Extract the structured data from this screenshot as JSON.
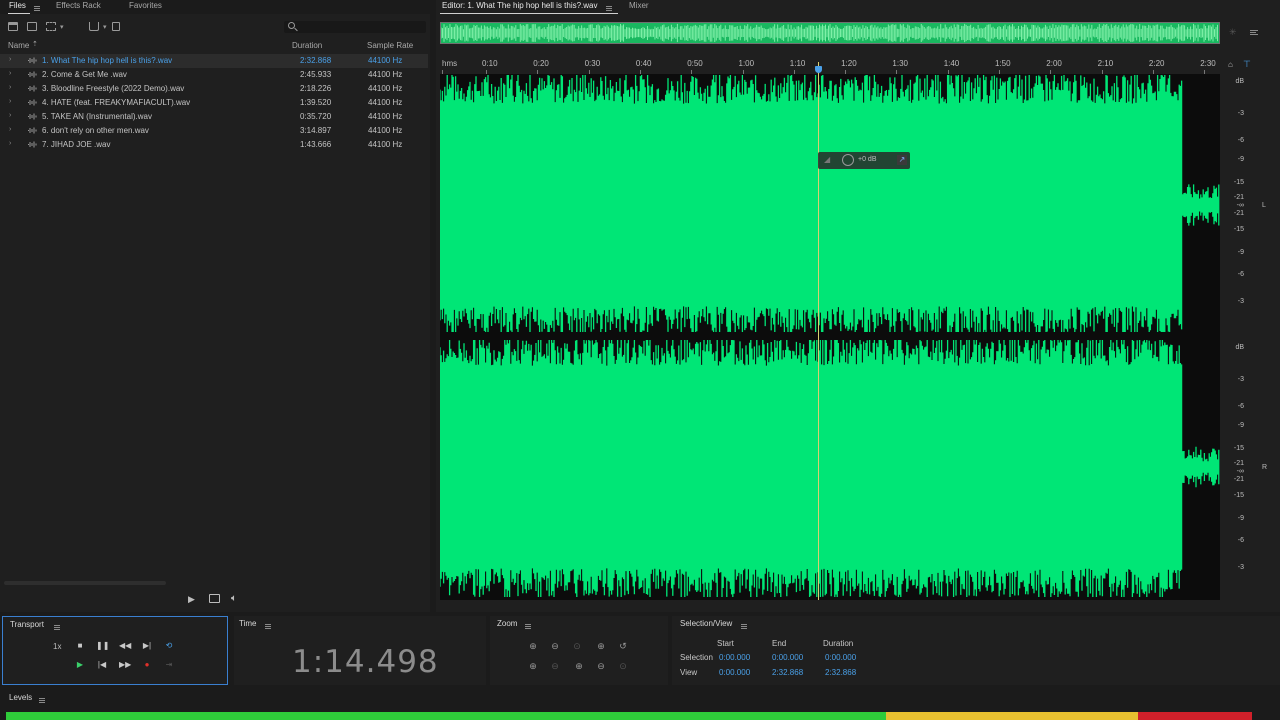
{
  "files_panel": {
    "tabs": [
      {
        "label": "Files",
        "active": true
      },
      {
        "label": "Effects Rack",
        "active": false
      },
      {
        "label": "Favorites",
        "active": false
      }
    ],
    "search": {
      "placeholder": ""
    },
    "columns": {
      "name": "Name",
      "duration": "Duration",
      "sample_rate": "Sample Rate"
    },
    "files": [
      {
        "name": "1. What The hip hop hell is this?.wav",
        "duration": "2:32.868",
        "sample_rate": "44100 Hz",
        "selected": true
      },
      {
        "name": "2. Come & Get Me .wav",
        "duration": "2:45.933",
        "sample_rate": "44100 Hz"
      },
      {
        "name": "3. Bloodline Freestyle (2022 Demo).wav",
        "duration": "2:18.226",
        "sample_rate": "44100 Hz"
      },
      {
        "name": "4. HATE (feat. FREAKYMAFIACULT).wav",
        "duration": "1:39.520",
        "sample_rate": "44100 Hz"
      },
      {
        "name": "5. TAKE AN (Instrumental).wav",
        "duration": "0:35.720",
        "sample_rate": "44100 Hz"
      },
      {
        "name": "6. don't rely on other men.wav",
        "duration": "3:14.897",
        "sample_rate": "44100 Hz"
      },
      {
        "name": "7. JIHAD JOE .wav",
        "duration": "1:43.666",
        "sample_rate": "44100 Hz"
      }
    ]
  },
  "editor": {
    "tab_label": "Editor: 1. What The hip hop hell is this?.wav",
    "mixer_label": "Mixer",
    "ruler_labels": [
      "hms",
      "0:10",
      "0:20",
      "0:30",
      "0:40",
      "0:50",
      "1:00",
      "1:10",
      "1:20",
      "1:30",
      "1:40",
      "1:50",
      "2:00",
      "2:10",
      "2:20",
      "2:30"
    ],
    "db_labels_top": [
      "dB",
      "-3",
      "-6",
      "-9",
      "-15",
      "-21",
      "-∞",
      "-21",
      "-15",
      "-9",
      "-6",
      "-3"
    ],
    "db_labels_bottom": [
      "dB",
      "-3",
      "-6",
      "-9",
      "-15",
      "-21",
      "-∞",
      "-21",
      "-15",
      "-9",
      "-6",
      "-3"
    ],
    "channel_left": "L",
    "channel_right": "R",
    "hud_gain": "+0 dB",
    "waveform_color": "#00e676",
    "playhead_color": "#d8d070"
  },
  "transport": {
    "title": "Transport",
    "speed": "1x",
    "icons": [
      "stop-icon",
      "pause-icon",
      "rewind-icon",
      "skip-to-end-icon",
      "loop-icon",
      "play-icon",
      "skip-to-start-icon",
      "fast-forward-icon",
      "record-icon",
      "skip-selection-icon"
    ]
  },
  "time": {
    "title": "Time",
    "value": "1:14.498"
  },
  "zoom": {
    "title": "Zoom"
  },
  "selection_view": {
    "title": "Selection/View",
    "headers": [
      "Start",
      "End",
      "Duration"
    ],
    "selection": {
      "label": "Selection",
      "start": "0:00.000",
      "end": "0:00.000",
      "duration": "0:00.000"
    },
    "view": {
      "label": "View",
      "start": "0:00.000",
      "end": "2:32.868",
      "duration": "2:32.868"
    }
  },
  "levels": {
    "title": "Levels"
  }
}
